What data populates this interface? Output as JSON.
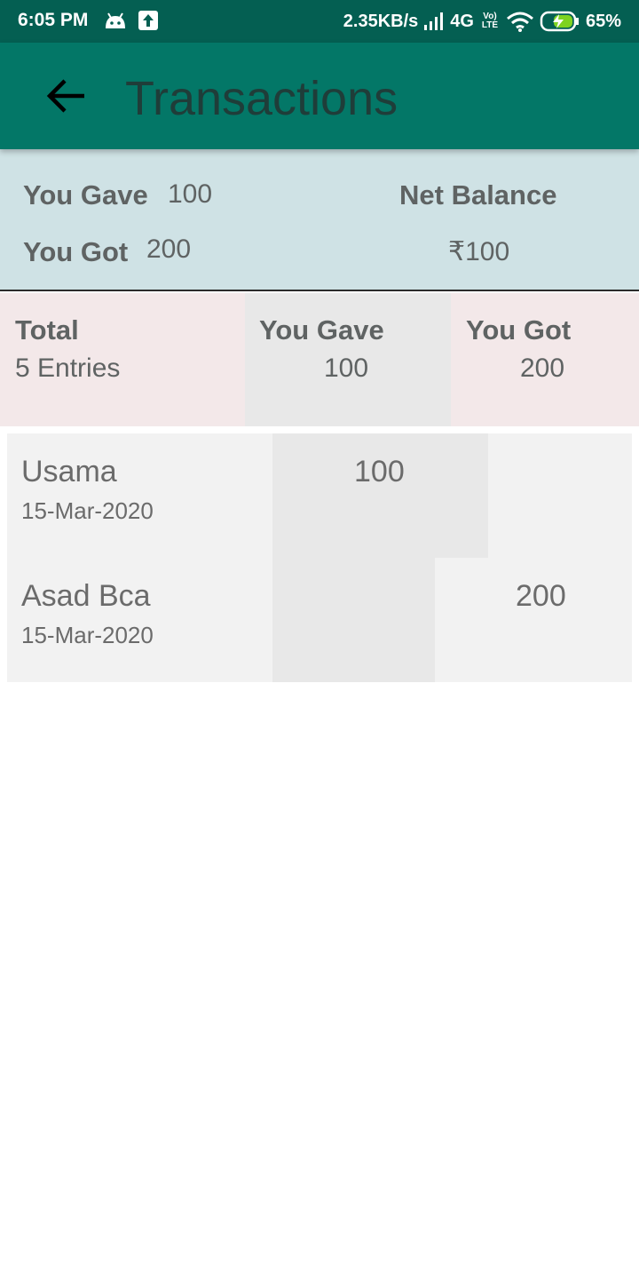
{
  "status_bar": {
    "time": "6:05 PM",
    "net_speed": "2.35KB/s",
    "network": "4G",
    "volte": "Vo) LTE",
    "battery": "65%",
    "icons": [
      "android-icon",
      "upload-icon",
      "signal-icon",
      "wifi-icon",
      "battery-charging-icon"
    ]
  },
  "app_bar": {
    "title": "Transactions",
    "back_icon": "arrow-left-icon"
  },
  "summary": {
    "you_gave_label": "You Gave",
    "you_gave_value": "100",
    "you_got_label": "You Got",
    "you_got_value": "200",
    "net_balance_label": "Net Balance",
    "net_balance_value": "₹100"
  },
  "totals": {
    "total_label": "Total",
    "entries": "5 Entries",
    "you_gave_label": "You Gave",
    "you_gave_value": "100",
    "you_got_label": "You Got",
    "you_got_value": "200"
  },
  "transactions": [
    {
      "name": "Usama",
      "date": "15-Mar-2020",
      "gave": "100",
      "got": ""
    },
    {
      "name": "Asad Bca",
      "date": "15-Mar-2020",
      "gave": "",
      "got": "200"
    }
  ],
  "colors": {
    "status_bar": "#045f52",
    "app_bar": "#037767",
    "summary_bg": "#cfe2e5",
    "totals_pink": "#f3e8e9",
    "totals_grey": "#e8e8e8",
    "list_bg": "#f2f2f2"
  }
}
